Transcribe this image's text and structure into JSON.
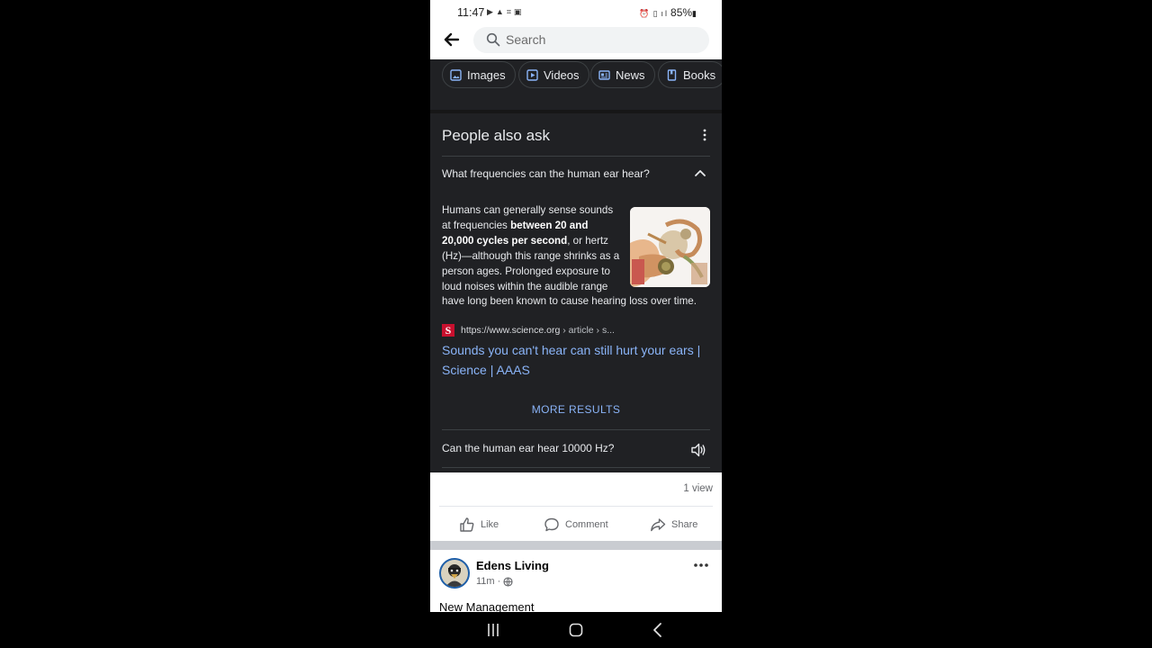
{
  "status_bar": {
    "time": "11:47",
    "left_icons": [
      "play-icon",
      "alert-icon",
      "screenshot-icon",
      "image-icon"
    ],
    "right_icons": [
      "alarm-icon",
      "vibrate-icon",
      "signal-icon"
    ],
    "battery": "85%"
  },
  "search": {
    "placeholder": "Search"
  },
  "chips": [
    {
      "label": "Images",
      "icon": "image-icon"
    },
    {
      "label": "Videos",
      "icon": "video-icon"
    },
    {
      "label": "News",
      "icon": "news-icon"
    },
    {
      "label": "Books",
      "icon": "book-icon"
    }
  ],
  "paa": {
    "title": "People also ask",
    "question1": "What frequencies can the human ear hear?",
    "answer": {
      "part1": "Humans can generally sense sounds at frequencies ",
      "bold": "between 20 and 20,000 cycles per second",
      "part2": ", or hertz (Hz)—although this range shrinks as a person ages. Prolonged exposure to loud noises within the audible range",
      "part3": "have long been known to cause hearing loss over time."
    },
    "source": {
      "favicon_letter": "S",
      "url": "https://www.science.org",
      "path": " › article › s...",
      "title": "Sounds you can't hear can still hurt your ears | Science | AAAS"
    },
    "more_results": "MORE RESULTS",
    "question2": "Can the human ear hear 10000 Hz?"
  },
  "facebook": {
    "views": "1 view",
    "actions": {
      "like": "Like",
      "comment": "Comment",
      "share": "Share"
    },
    "post": {
      "author": "Edens Living",
      "time": "11m",
      "separator": "·",
      "text": "New Management"
    }
  },
  "colors": {
    "dark_bg": "#202124",
    "link_blue": "#8ab4f8",
    "fb_gray": "#65676b"
  }
}
